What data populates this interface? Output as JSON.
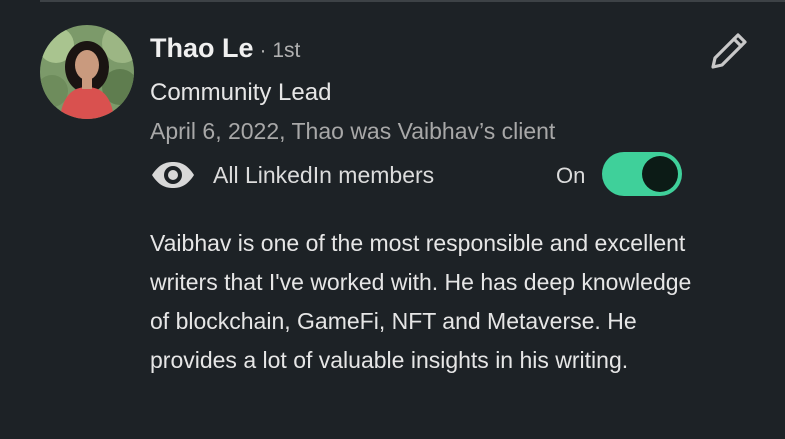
{
  "recommendation": {
    "author_name": "Thao Le",
    "connection_degree": "· 1st",
    "headline": "Community Lead",
    "meta": "April 6, 2022, Thao was Vaibhav’s client",
    "visibility_label": "All LinkedIn members",
    "toggle_state": "On",
    "body": "Vaibhav is one of the most responsible and excellent writers that I've worked with. He has deep knowledge of blockchain, GameFi, NFT and Metaverse. He provides a lot of valuable insights in his writing."
  },
  "icons": {
    "edit": "pencil-icon",
    "visibility": "eye-icon"
  },
  "colors": {
    "background": "#1d2226",
    "toggle_on": "#3fd09a",
    "text_primary": "#e6e6e6",
    "text_secondary": "#a8a8a8"
  }
}
